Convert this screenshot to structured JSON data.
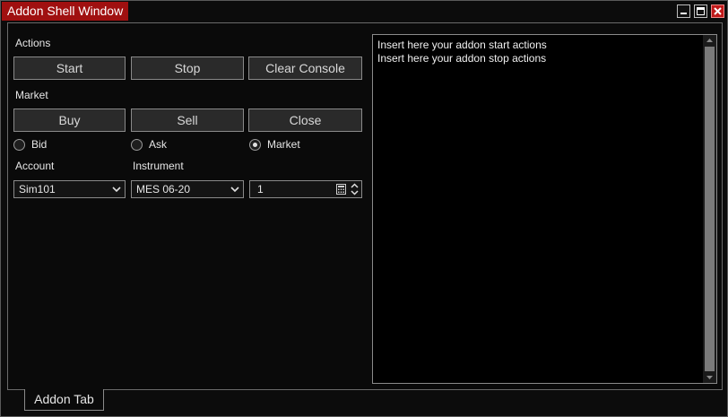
{
  "window": {
    "title": "Addon Shell Window"
  },
  "actions": {
    "header": "Actions",
    "start_label": "Start",
    "stop_label": "Stop",
    "clear_label": "Clear Console"
  },
  "market": {
    "header": "Market",
    "buy_label": "Buy",
    "sell_label": "Sell",
    "close_label": "Close",
    "price_options": [
      {
        "label": "Bid",
        "selected": false
      },
      {
        "label": "Ask",
        "selected": false
      },
      {
        "label": "Market",
        "selected": true
      }
    ]
  },
  "account": {
    "label": "Account",
    "value": "Sim101"
  },
  "instrument": {
    "label": "Instrument",
    "value": "MES 06-20"
  },
  "quantity": {
    "value": "1"
  },
  "console": {
    "lines": [
      "Insert here your addon start actions",
      "Insert here your addon stop actions"
    ]
  },
  "tabs": [
    {
      "label": "Addon Tab",
      "active": true
    }
  ]
}
